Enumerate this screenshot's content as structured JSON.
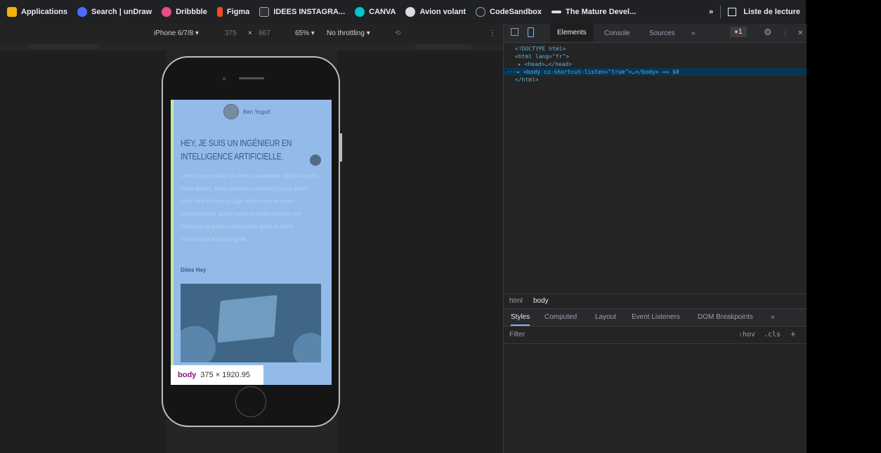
{
  "bookmarks": [
    {
      "label": "Applications",
      "icon": "grid-icon",
      "color": "#f4b400"
    },
    {
      "label": "Search | unDraw",
      "icon": "undraw-icon",
      "color": "#4a6cf7"
    },
    {
      "label": "Dribbble",
      "icon": "dribbble-icon",
      "color": "#ea4c89"
    },
    {
      "label": "Figma",
      "icon": "figma-icon",
      "color": "#f24e1e"
    },
    {
      "label": "IDEES INSTAGRA...",
      "icon": "instagram-idea-icon",
      "color": "#333333"
    },
    {
      "label": "CANVA",
      "icon": "canva-icon",
      "color": "#00c4cc"
    },
    {
      "label": "Avion volant",
      "icon": "globe-icon",
      "color": "#9aa0a6"
    },
    {
      "label": "CodeSandbox",
      "icon": "codesandbox-icon",
      "color": "#9aa0a6"
    },
    {
      "label": "The Mature Devel...",
      "icon": "mustache-icon",
      "color": "#9aa0a6"
    }
  ],
  "bookmarks_more": "»",
  "reading_list": "Liste de lecture",
  "device_toolbar": {
    "device": "iPhone 6/7/8 ▾",
    "width": "375",
    "times": "×",
    "height": "667",
    "zoom": "65% ▾",
    "throttling": "No throttling ▾",
    "rotate": "⟲",
    "more": "⋮"
  },
  "page": {
    "name": "Ben Yogurt",
    "headline_1": "HEY, JE SUIS UN INGÉNIEUR EN",
    "headline_2": "INTELLIGENCE ARTIFICIELLE.",
    "paragraph": "Lorem ipsum dolor sit amet, consectetur adipisicing elit. Dicta debitis, facilis aliquam voluptates fugiat ipsum odio, nihil architecto fuga laboriosam tempore necessitatibus quam! Incidunt nobis ducimus vel, deserunt sit quod Lorem ipsum dolor sit amet consectetur adipisicing elit.",
    "signature": "Dites Hey"
  },
  "inspect_badge": {
    "tag": "body",
    "size": "375 × 1920.95"
  },
  "devtools": {
    "tabs": [
      "Elements",
      "Console",
      "Sources",
      "»"
    ],
    "error_count": "1",
    "code_lines": [
      {
        "text": "<!DOCTYPE html>"
      },
      {
        "text": "<html lang=\"fr\">"
      },
      {
        "text": "▸ <head>…</head>"
      },
      {
        "text": "···▸ <body cz-shortcut-listen=\"true\">…</body> == $0"
      },
      {
        "text": "</html>"
      }
    ],
    "breadcrumbs": [
      "html",
      "body"
    ],
    "styles_tabs": [
      "Styles",
      "Computed",
      "Layout",
      "Event Listeners",
      "DOM Breakpoints",
      "»"
    ],
    "filter_placeholder": "Filter",
    "hov": ":hov",
    "cls": ".cls",
    "plus": "+"
  }
}
